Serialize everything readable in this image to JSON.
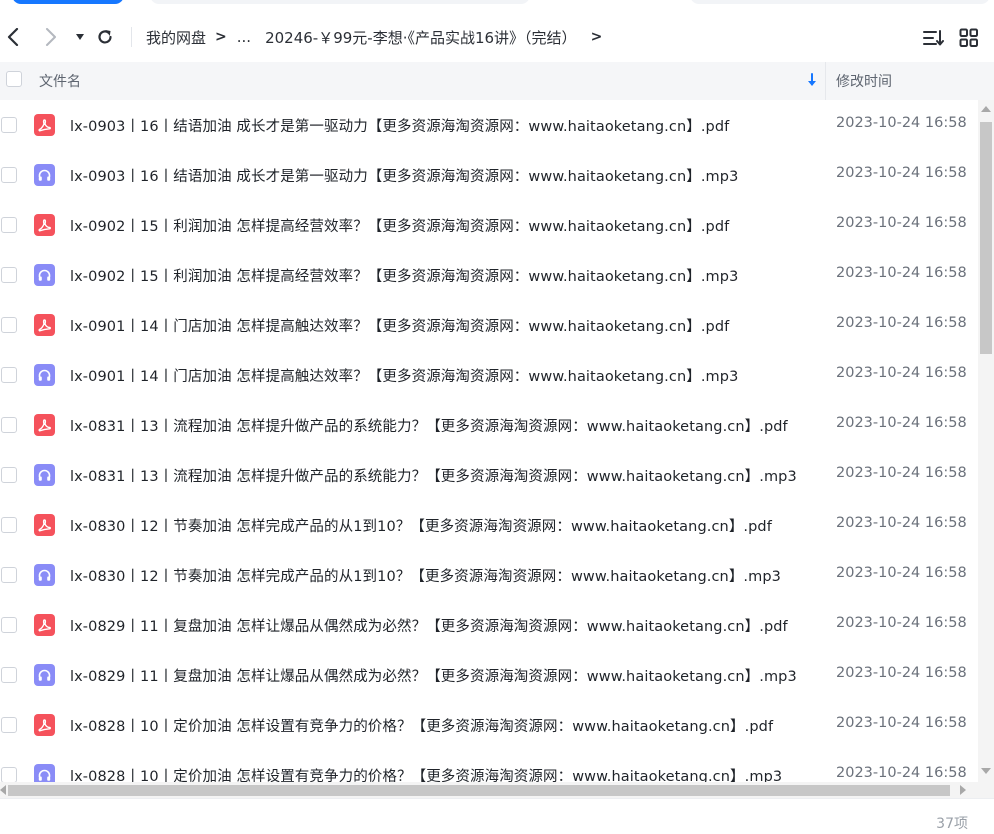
{
  "nav": {
    "back_icon": "chevron-left-icon",
    "forward_icon": "chevron-right-icon",
    "dropdown_icon": "caret-down-icon",
    "refresh_icon": "refresh-icon"
  },
  "breadcrumb": {
    "root": "我的网盘",
    "sep1": ">",
    "ellipsis": "...",
    "current": "20246-￥99元-李想·《产品实战16讲》（完结）",
    "sep_end": ">"
  },
  "toolbar": {
    "sort_icon": "sort-lines-icon",
    "grid_icon": "grid-view-icon"
  },
  "table": {
    "col_name": "文件名",
    "col_time": "修改时间",
    "sort_direction_icon": "arrow-down-icon"
  },
  "files": [
    {
      "name": "lx-0903丨16丨结语加油   成长才是第一驱动力【更多资源海淘资源网：www.haitaoketang.cn】.pdf",
      "type": "pdf",
      "time": "2023-10-24 16:58"
    },
    {
      "name": "lx-0903丨16丨结语加油   成长才是第一驱动力【更多资源海淘资源网：www.haitaoketang.cn】.mp3",
      "type": "mp3",
      "time": "2023-10-24 16:58"
    },
    {
      "name": "lx-0902丨15丨利润加油   怎样提高经营效率？【更多资源海淘资源网：www.haitaoketang.cn】.pdf",
      "type": "pdf",
      "time": "2023-10-24 16:58"
    },
    {
      "name": "lx-0902丨15丨利润加油   怎样提高经营效率？【更多资源海淘资源网：www.haitaoketang.cn】.mp3",
      "type": "mp3",
      "time": "2023-10-24 16:58"
    },
    {
      "name": "lx-0901丨14丨门店加油   怎样提高触达效率？【更多资源海淘资源网：www.haitaoketang.cn】.pdf",
      "type": "pdf",
      "time": "2023-10-24 16:58"
    },
    {
      "name": "lx-0901丨14丨门店加油   怎样提高触达效率？【更多资源海淘资源网：www.haitaoketang.cn】.mp3",
      "type": "mp3",
      "time": "2023-10-24 16:58"
    },
    {
      "name": "lx-0831丨13丨流程加油   怎样提升做产品的系统能力？【更多资源海淘资源网：www.haitaoketang.cn】.pdf",
      "type": "pdf",
      "time": "2023-10-24 16:58"
    },
    {
      "name": "lx-0831丨13丨流程加油   怎样提升做产品的系统能力？【更多资源海淘资源网：www.haitaoketang.cn】.mp3",
      "type": "mp3",
      "time": "2023-10-24 16:58"
    },
    {
      "name": "lx-0830丨12丨节奏加油   怎样完成产品的从1到10？【更多资源海淘资源网：www.haitaoketang.cn】.pdf",
      "type": "pdf",
      "time": "2023-10-24 16:58"
    },
    {
      "name": "lx-0830丨12丨节奏加油   怎样完成产品的从1到10？【更多资源海淘资源网：www.haitaoketang.cn】.mp3",
      "type": "mp3",
      "time": "2023-10-24 16:58"
    },
    {
      "name": "lx-0829丨11丨复盘加油   怎样让爆品从偶然成为必然？【更多资源海淘资源网：www.haitaoketang.cn】.pdf",
      "type": "pdf",
      "time": "2023-10-24 16:58"
    },
    {
      "name": "lx-0829丨11丨复盘加油   怎样让爆品从偶然成为必然？【更多资源海淘资源网：www.haitaoketang.cn】.mp3",
      "type": "mp3",
      "time": "2023-10-24 16:58"
    },
    {
      "name": "lx-0828丨10丨定价加油   怎样设置有竞争力的价格？【更多资源海淘资源网：www.haitaoketang.cn】.pdf",
      "type": "pdf",
      "time": "2023-10-24 16:58"
    },
    {
      "name": "lx-0828丨10丨定价加油   怎样设置有竞争力的价格？【更多资源海淘资源网：www.haitaoketang.cn】.mp3",
      "type": "mp3",
      "time": "2023-10-24 16:58"
    }
  ],
  "footer": {
    "count": "37项"
  },
  "colors": {
    "pdf_icon": "#f5525c",
    "mp3_icon": "#8a8cf7",
    "accent": "#1677ff",
    "header_bg": "#f5f6f8"
  }
}
